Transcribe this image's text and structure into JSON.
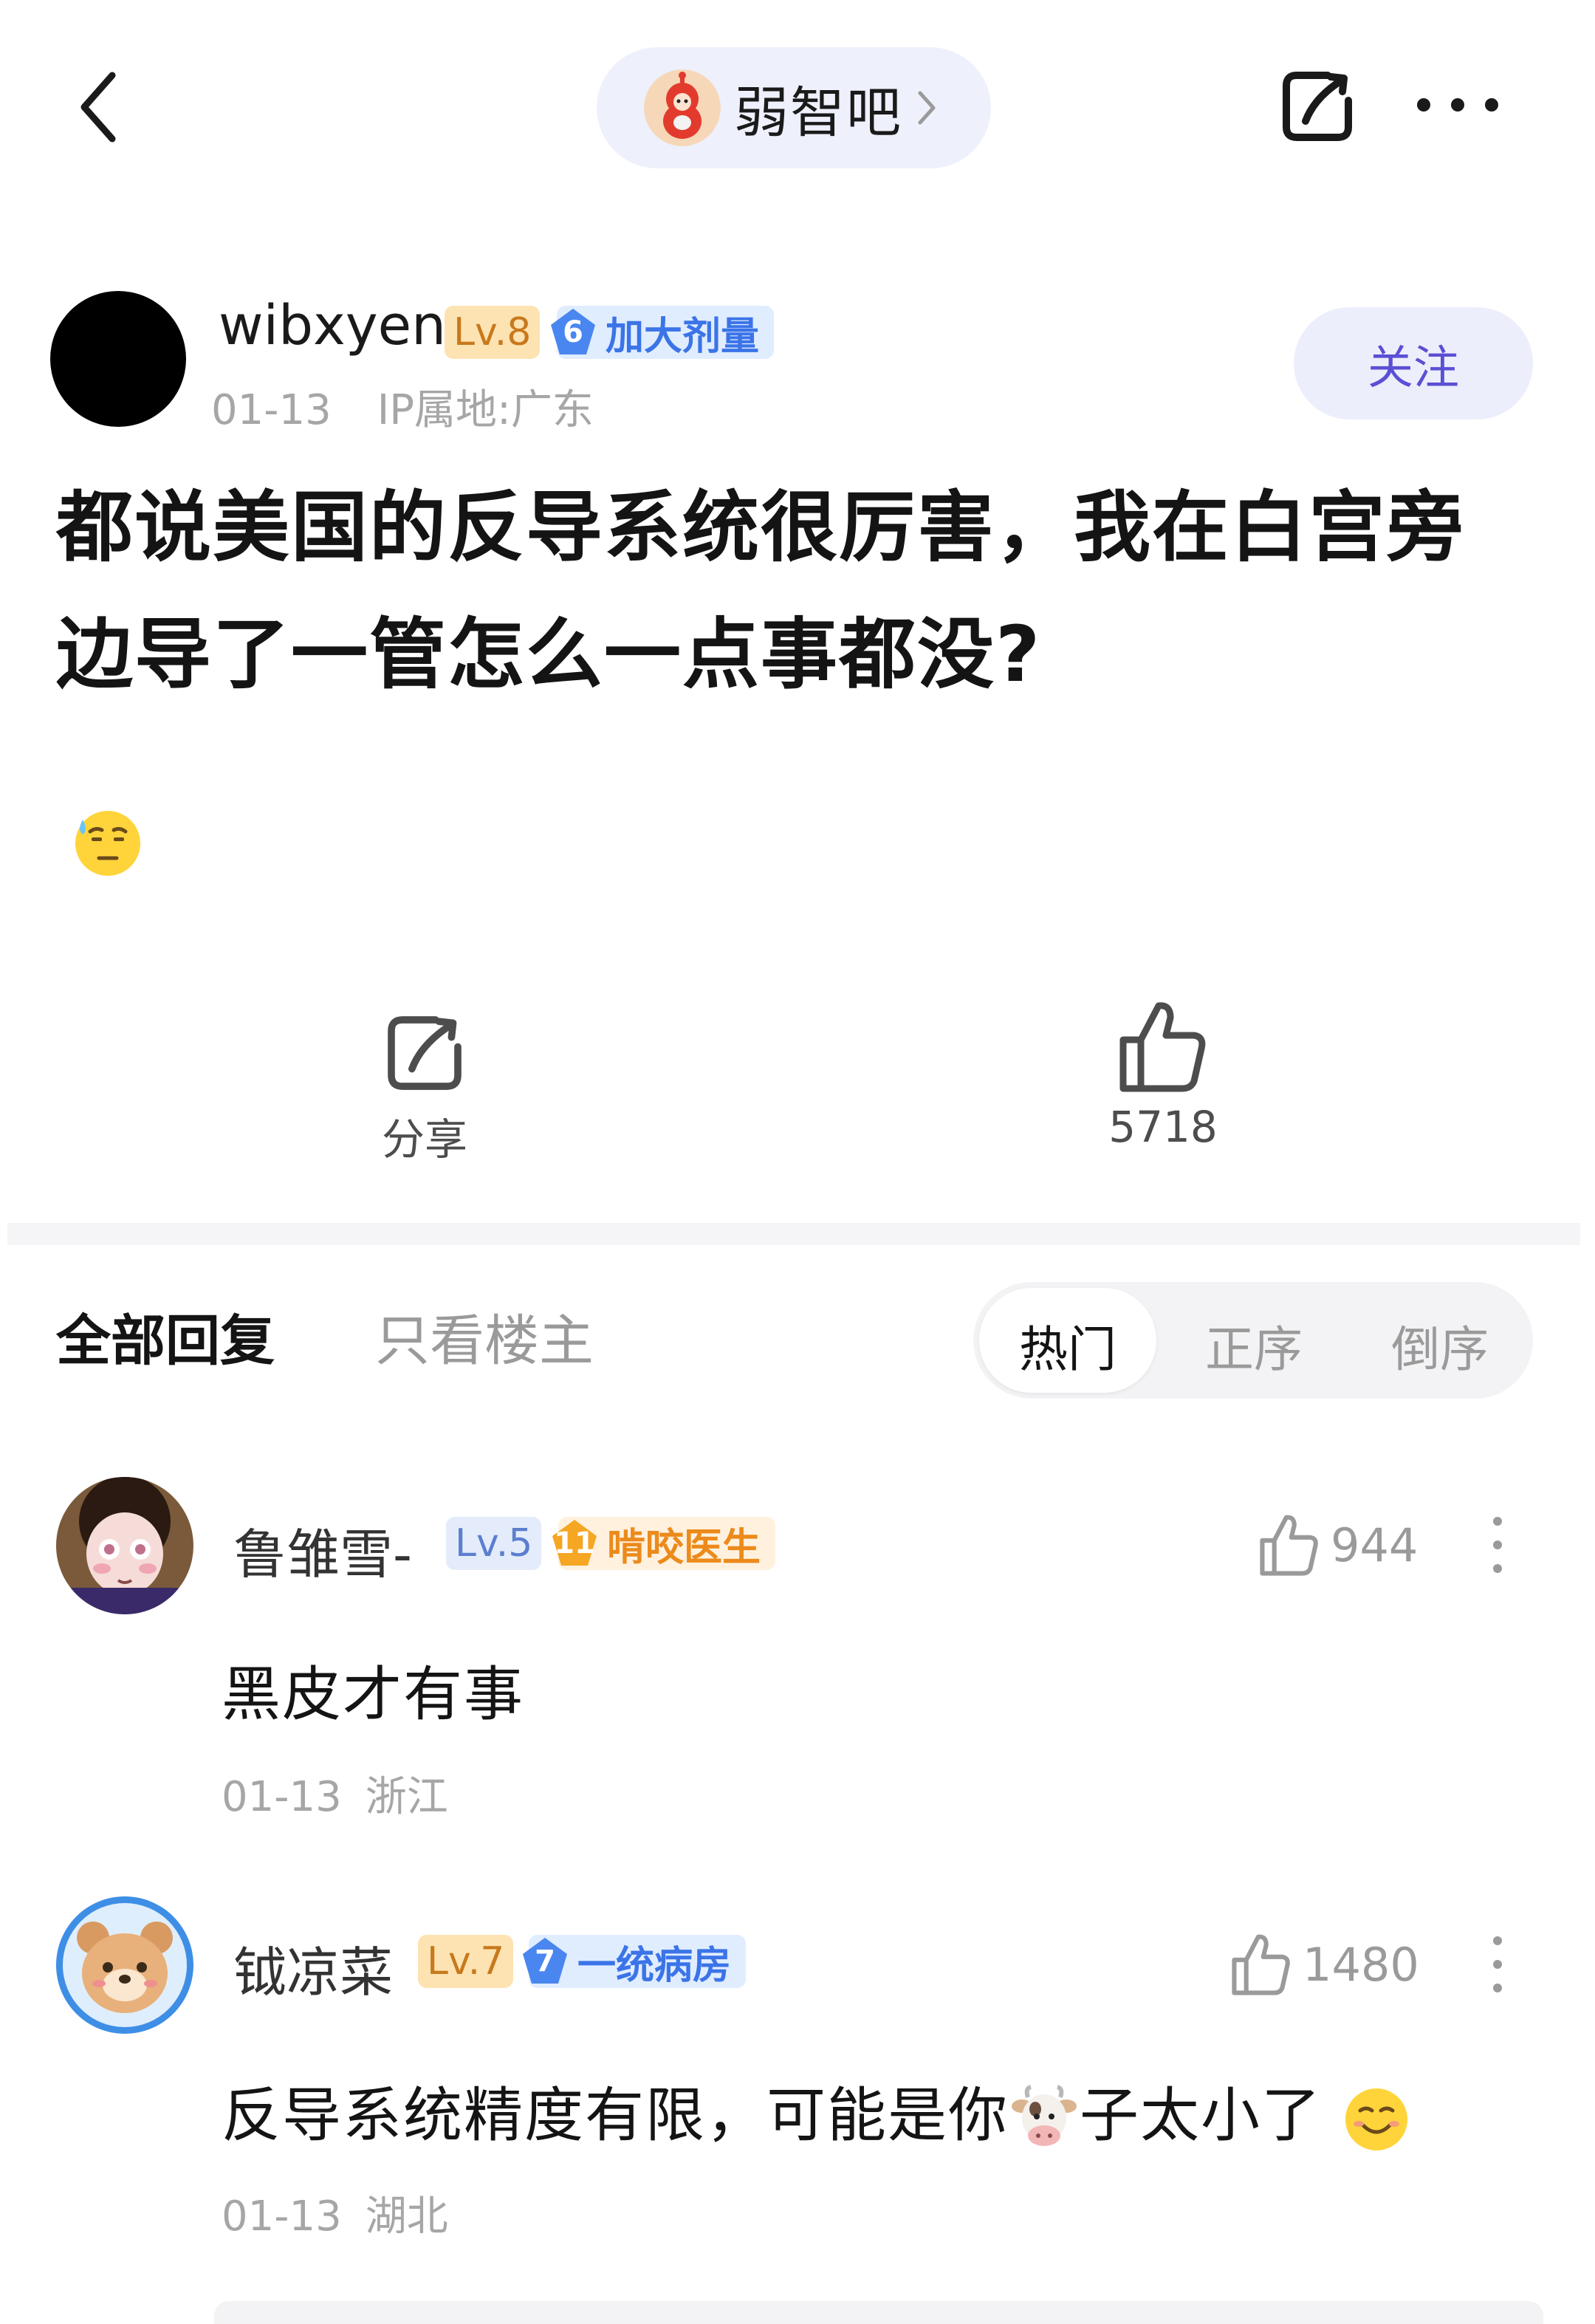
{
  "header": {
    "forum_name": "弱智吧",
    "icons": [
      "back-icon",
      "chevron-right-icon",
      "share-icon",
      "more-icon"
    ]
  },
  "post": {
    "author": {
      "name": "wibxyen",
      "level": "Lv.8",
      "title_level": "6",
      "title": "加大剂量"
    },
    "date": "01-13",
    "ip_location": "IP属地:广东",
    "follow_label": "关注",
    "title": "都说美国的反导系统很厉害，我在白宫旁边导了一管怎么一点事都没?",
    "emoji": "sweat-smile-emoji",
    "actions": {
      "share_label": "分享",
      "like_count": "5718"
    }
  },
  "replies_header": {
    "tab_all": "全部回复",
    "tab_op_only": "只看楼主",
    "sort_options": [
      "热门",
      "正序",
      "倒序"
    ],
    "sort_selected": "热门"
  },
  "comments": [
    {
      "user": "鲁雏雪-",
      "level": "Lv.5",
      "title_level": "11",
      "title": "啃咬医生",
      "likes": "944",
      "text": "黑皮才有事",
      "date": "01-13",
      "location": "浙江"
    },
    {
      "user": "钺凉菜",
      "level": "Lv.7",
      "title_level": "7",
      "title": "一统病房",
      "likes": "1480",
      "text_before": "反导系统精度有限，可能是你",
      "text_after": "子太小了",
      "inline_icons": [
        "cow-emoji",
        "smile-emoji"
      ],
      "date": "01-13",
      "location": "湖北"
    }
  ],
  "colors": {
    "accent_purple": "#5b4fd4",
    "pill_bg": "#eef0fb",
    "level_orange": "#c8791c",
    "title_blue": "#3b74e8",
    "title_orange": "#ec8a1b",
    "meta_gray": "#a6a6a6"
  }
}
